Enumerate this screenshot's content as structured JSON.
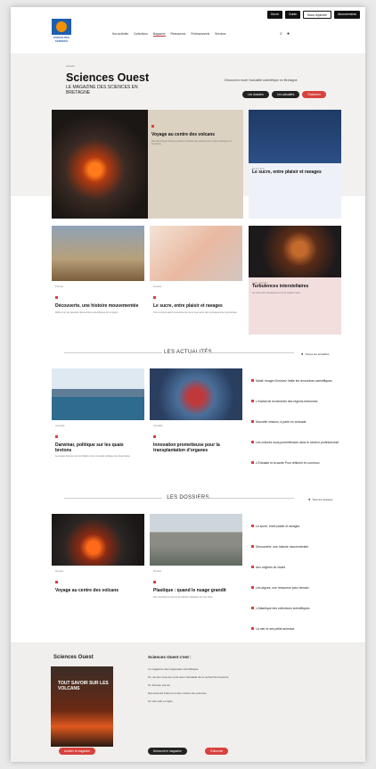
{
  "topbar": [
    "Ouvrir",
    "Guide",
    "Nous rejoindre",
    "Abonnements"
  ],
  "logo": {
    "caption": "ESPACE DES SCIENCES"
  },
  "nav": [
    "Nos activités",
    "Collections",
    "Magazine",
    "Ressources",
    "Professionnels",
    "Services"
  ],
  "hero": {
    "kicker": "Accueil",
    "title": "Sciences Ouest",
    "subtitle": "LE MAGAZINE DES SCIENCES EN BRETAGNE",
    "description": "Découvrez toute l'actualité scientifique en Bretagne",
    "buttons": [
      "Les dossiers",
      "Les actualités",
      "S'abonner"
    ]
  },
  "feature_cards": [
    {
      "tag": "Dossier",
      "title": "Voyage au centre des volcans",
      "desc": "Des chercheurs bretons étudient l'activité des volcans pour mieux anticiper les éruptions."
    },
    {
      "tag": "Fil de l'actu",
      "title": "Le sucre, entre plaisir et ravages",
      "desc": ""
    },
    {
      "tag": "Portrait",
      "title": "Découverte, une histoire mouvementée",
      "desc": "Retour sur les grandes découvertes scientifiques de la région."
    },
    {
      "tag": "Dossier",
      "title": "Le sucre, entre plaisir et ravages",
      "desc": "Une consommation excessive de sucre peut avoir des conséquences importantes."
    },
    {
      "tag": "Carte blanche",
      "title": "Turbulences interstellaires",
      "desc": "Au cœur des nébuleuses et de la matière noire."
    }
  ],
  "actus": {
    "heading": "LES ACTUALITÉS",
    "see_all": "Toutes les actualités",
    "cards": [
      {
        "tag": "Actualité",
        "title": "Darwinar, politique sur les quais bretons",
        "desc": "Les quais bretons sont le théâtre d'une nouvelle politique de préservation."
      },
      {
        "tag": "Actualité",
        "title": "Innovation prometteuse pour la transplantation d'organes",
        "desc": ""
      }
    ],
    "side": [
      "Manif: Image d'Innovez Imilie les rencontres scientifiques",
      "L'Institut de recherches des régions bretonnes",
      "Nouvelle mission, à partir en croisade",
      "Les cultures sous-prometteuses dans le secteur professionnel",
      "L'Entraide et la santé Pour réfléchir en commun"
    ]
  },
  "dossiers": {
    "heading": "LES DOSSIERS",
    "see_all": "Tous les dossiers",
    "cards": [
      {
        "tag": "Dossier",
        "title": "Voyage au centre des volcans",
        "desc": ""
      },
      {
        "tag": "Dossier",
        "title": "Plastique : quand le nuage grandit",
        "desc": "Des chercheurs suivent la pollution plastique sur les côtes."
      }
    ],
    "side": [
      "Le sucre, entre plaisir et ravages",
      "Découverte, une histoire mouvementée",
      "Aux origines du vivant",
      "Les algues, une ressource pour demain",
      "L'Atlantique des collections scientifiques",
      "La mer et ses petits animaux"
    ]
  },
  "footer": {
    "title": "Sciences Ouest",
    "mag_cover": "TOUT SAVOIR SUR LES VOLCANS",
    "info_title": "Sciences Ouest c'est :",
    "items": [
      "Le magazine des régionales scientifiques",
      "Un numéro tous les mois avec l'actualité de la recherche bretonne",
      "Un Dossier par an",
      "Des lecteurs bretons et des curieux de sciences",
      "Un site web en ligne"
    ],
    "buttons": [
      "Acheter le magazine",
      "Découvrir le magazine",
      "S'abonner"
    ]
  }
}
